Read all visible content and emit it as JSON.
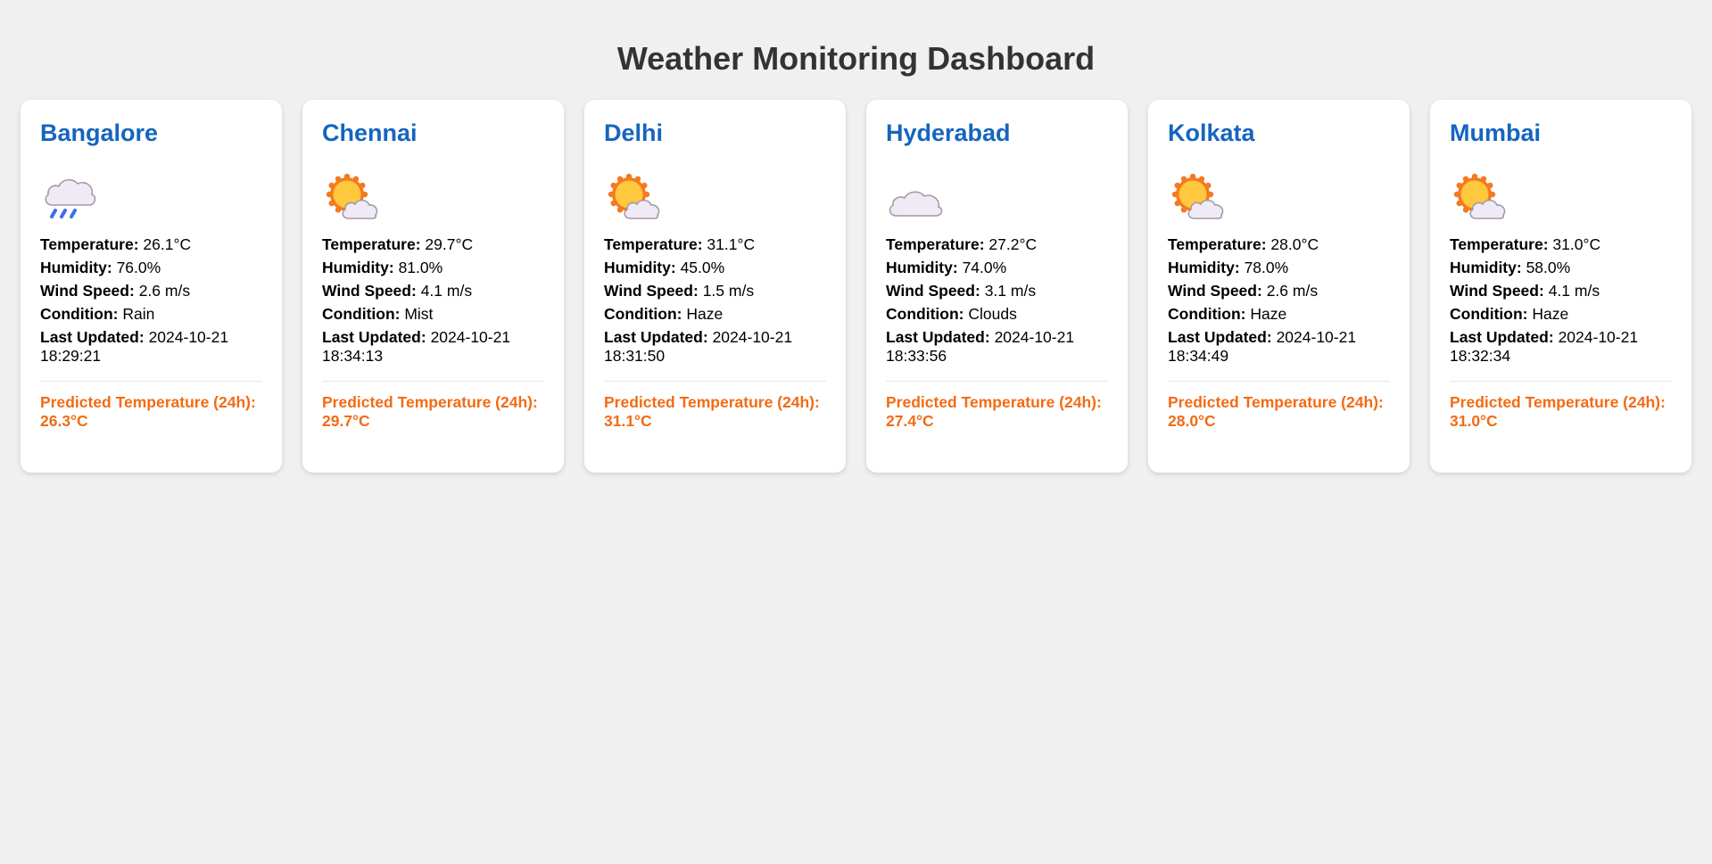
{
  "page": {
    "title": "Weather Monitoring Dashboard"
  },
  "labels": {
    "temperature": "Temperature:",
    "humidity": "Humidity:",
    "wind_speed": "Wind Speed:",
    "condition": "Condition:",
    "last_updated": "Last Updated:",
    "prediction": "Predicted Temperature (24h):"
  },
  "colors": {
    "background": "#f0f0f0",
    "title": "#333333",
    "city": "#1565c0",
    "prediction": "#f26b14",
    "card": "#ffffff"
  },
  "cities": [
    {
      "name": "Bangalore",
      "icon": "rain-cloud-icon",
      "temperature": "26.1°C",
      "humidity": "76.0%",
      "wind_speed": "2.6 m/s",
      "condition": "Rain",
      "last_updated": "2024-10-21 18:29:21",
      "predicted": "26.3°C"
    },
    {
      "name": "Chennai",
      "icon": "sun-behind-cloud-icon",
      "temperature": "29.7°C",
      "humidity": "81.0%",
      "wind_speed": "4.1 m/s",
      "condition": "Mist",
      "last_updated": "2024-10-21 18:34:13",
      "predicted": "29.7°C"
    },
    {
      "name": "Delhi",
      "icon": "sun-behind-cloud-icon",
      "temperature": "31.1°C",
      "humidity": "45.0%",
      "wind_speed": "1.5 m/s",
      "condition": "Haze",
      "last_updated": "2024-10-21 18:31:50",
      "predicted": "31.1°C"
    },
    {
      "name": "Hyderabad",
      "icon": "cloud-icon",
      "temperature": "27.2°C",
      "humidity": "74.0%",
      "wind_speed": "3.1 m/s",
      "condition": "Clouds",
      "last_updated": "2024-10-21 18:33:56",
      "predicted": "27.4°C"
    },
    {
      "name": "Kolkata",
      "icon": "sun-behind-cloud-icon",
      "temperature": "28.0°C",
      "humidity": "78.0%",
      "wind_speed": "2.6 m/s",
      "condition": "Haze",
      "last_updated": "2024-10-21 18:34:49",
      "predicted": "28.0°C"
    },
    {
      "name": "Mumbai",
      "icon": "sun-behind-cloud-icon",
      "temperature": "31.0°C",
      "humidity": "58.0%",
      "wind_speed": "4.1 m/s",
      "condition": "Haze",
      "last_updated": "2024-10-21 18:32:34",
      "predicted": "31.0°C"
    }
  ]
}
